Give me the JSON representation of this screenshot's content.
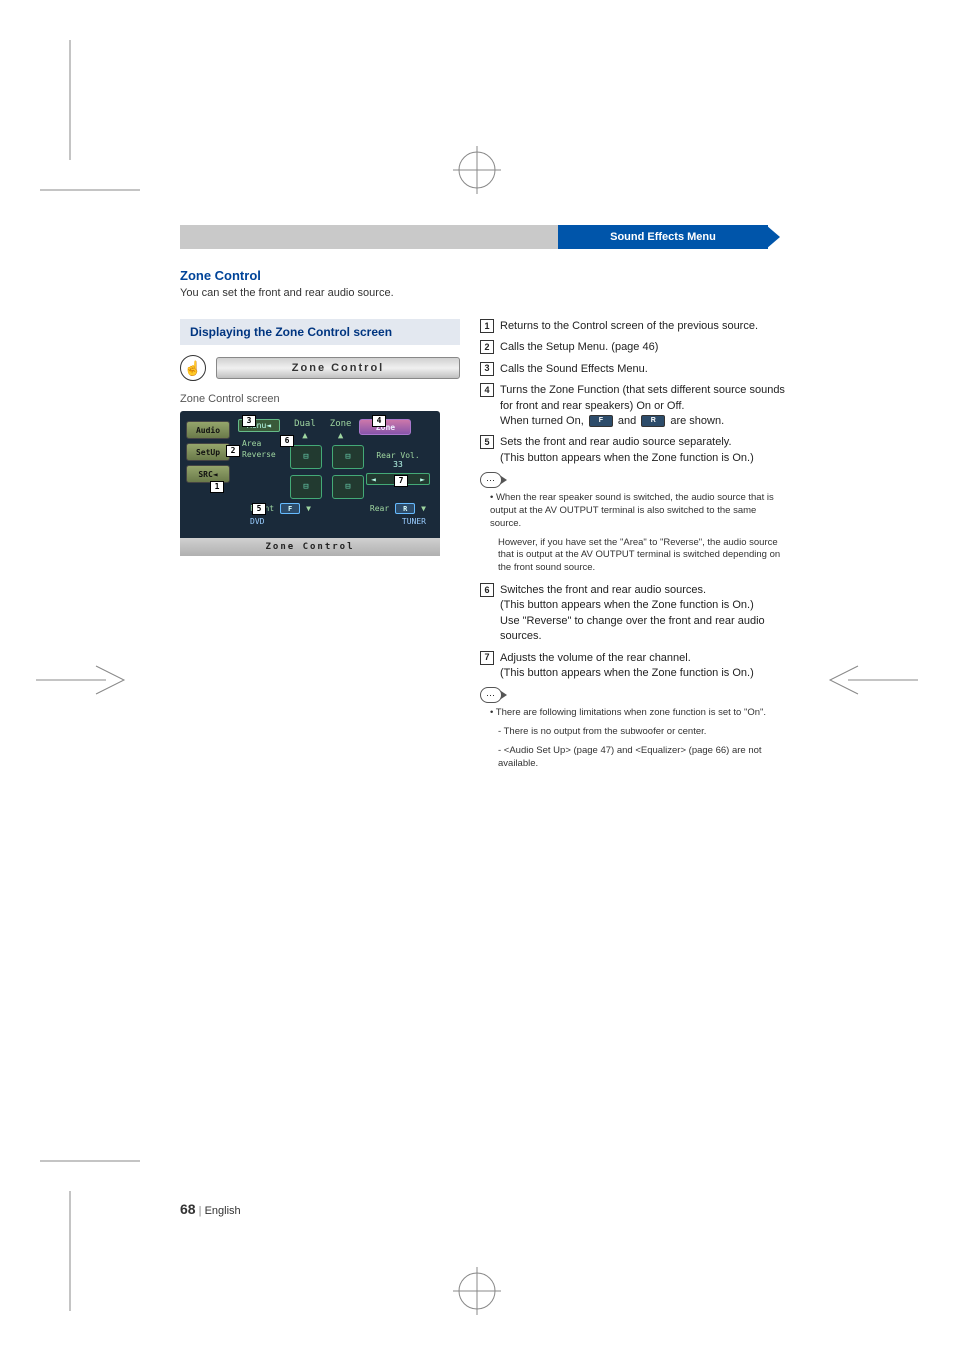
{
  "header": {
    "tab_label": "Sound Effects Menu"
  },
  "section": {
    "title": "Zone Control",
    "desc": "You can set the front and rear audio source."
  },
  "subpanel": {
    "title": "Displaying the Zone Control screen"
  },
  "instruction": {
    "button_label": "Zone Control"
  },
  "screen_label": "Zone Control screen",
  "screenshot": {
    "left_buttons": {
      "audio": "Audio",
      "setup": "SetUp",
      "src": "SRC◄"
    },
    "menu_label": "Menu◄",
    "dual_label": "Dual",
    "zone_label": "Zone",
    "zone_badge": "Zone",
    "area_label": "Area",
    "reverse_label": "Reverse",
    "rear_vol_label": "Rear Vol.",
    "rear_vol_value": "33",
    "front_label": "Front",
    "rear_label": "Rear",
    "front_src": "DVD",
    "rear_src": "TUNER",
    "front_badge": "F",
    "rear_badge": "R",
    "footer_label": "Zone Control"
  },
  "callouts": {
    "c1": "1",
    "c2": "2",
    "c3": "3",
    "c4": "4",
    "c5": "5",
    "c6": "6",
    "c7": "7"
  },
  "items": {
    "i1": "Returns to the Control screen of the previous source.",
    "i2": "Calls the Setup Menu. (page 46)",
    "i3": "Calls the Sound Effects Menu.",
    "i4a": "Turns the Zone Function (that sets different source sounds for front and rear speakers) On or Off.",
    "i4b_pre": "When turned On, ",
    "i4b_mid": " and ",
    "i4b_post": " are shown.",
    "badge_f": "F",
    "badge_r": "R",
    "i5a": "Sets the front and rear audio source separately.",
    "i5b": "(This button appears when the Zone function is On.)",
    "i6a": "Switches the front and rear audio sources.",
    "i6b": "(This button appears when the Zone function is On.)",
    "i6c": "Use \"Reverse\" to change over the front and rear audio sources.",
    "i7a": "Adjusts the volume of the rear channel.",
    "i7b": "(This button appears when the Zone function is On.)"
  },
  "notes": {
    "n1a": "When the rear speaker sound is switched, the audio source that is output at the AV OUTPUT terminal is also switched to the same source.",
    "n1b": "However, if you have set the \"Area\" to \"Reverse\", the audio source that is output at the AV OUTPUT terminal is switched depending on the front sound source.",
    "n2a": "There are following limitations when zone function is set to \"On\".",
    "n2b": "- There is no output from the subwoofer or center.",
    "n2c": "- <Audio Set Up> (page 47) and <Equalizer> (page 66) are not available."
  },
  "footer": {
    "page_num": "68",
    "lang": "English"
  }
}
